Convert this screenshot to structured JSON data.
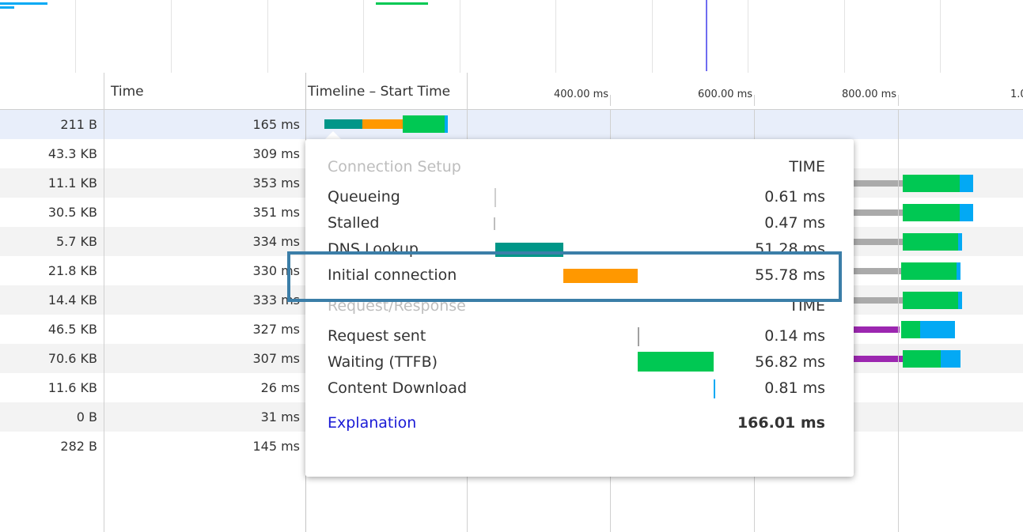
{
  "header": {
    "time_label": "Time",
    "timeline_label": "Timeline – Start Time",
    "ticks": [
      "400.00 ms",
      "600.00 ms",
      "800.00 ms",
      "1.0"
    ]
  },
  "rows": [
    {
      "size": "211 B",
      "time": "165 ms"
    },
    {
      "size": "43.3 KB",
      "time": "309 ms"
    },
    {
      "size": "11.1 KB",
      "time": "353 ms"
    },
    {
      "size": "30.5 KB",
      "time": "351 ms"
    },
    {
      "size": "5.7 KB",
      "time": "334 ms"
    },
    {
      "size": "21.8 KB",
      "time": "330 ms"
    },
    {
      "size": "14.4 KB",
      "time": "333 ms"
    },
    {
      "size": "46.5 KB",
      "time": "327 ms"
    },
    {
      "size": "70.6 KB",
      "time": "307 ms"
    },
    {
      "size": "11.6 KB",
      "time": "26 ms"
    },
    {
      "size": "0 B",
      "time": "31 ms"
    },
    {
      "size": "282 B",
      "time": "145 ms"
    }
  ],
  "popup": {
    "section1": "Connection Setup",
    "section2": "Request/Response",
    "time_header": "TIME",
    "items": [
      {
        "label": "Queueing",
        "value": "0.61 ms"
      },
      {
        "label": "Stalled",
        "value": "0.47 ms"
      },
      {
        "label": "DNS Lookup",
        "value": "51.28 ms"
      },
      {
        "label": "Initial connection",
        "value": "55.78 ms"
      },
      {
        "label": "Request sent",
        "value": "0.14 ms"
      },
      {
        "label": "Waiting (TTFB)",
        "value": "56.82 ms"
      },
      {
        "label": "Content Download",
        "value": "0.81 ms"
      }
    ],
    "explanation": "Explanation",
    "total": "166.01 ms"
  },
  "colors": {
    "queueing": "#bbbbbb",
    "dns": "#009688",
    "initial_connection": "#ff9800",
    "waiting": "#00c853",
    "download": "#03a9f4",
    "request_sent": "#a0a0a0",
    "stalled_gray": "#aaaaaa",
    "purple": "#9c27b0",
    "highlight_border": "#3b7ea8",
    "link": "#1a1ad6"
  }
}
